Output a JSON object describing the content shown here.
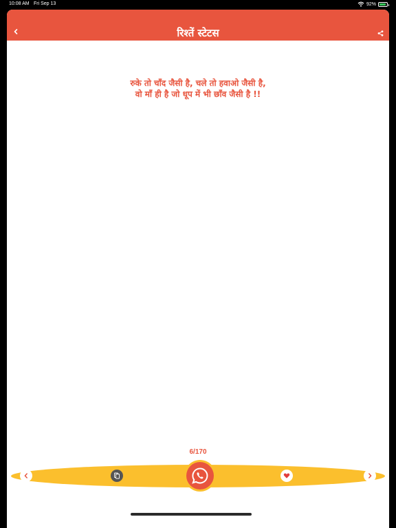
{
  "status_bar": {
    "time": "10:08 AM",
    "date": "Fri Sep 13",
    "battery": "92%"
  },
  "header": {
    "title": "रिश्तें स्टेटस"
  },
  "quote": {
    "line1": "रुके तो चाँद जैसी है, चले तो हवाओ जैसी है,",
    "line2": "वो माँ ही है जो धूप में भी छाँव जैसी है !!"
  },
  "counter": "6/170",
  "colors": {
    "accent": "#e8553e",
    "toolbar": "#fbbf2d"
  },
  "icons": {
    "back": "chevron-left-icon",
    "share": "share-icon",
    "prev": "chevron-left-icon",
    "copy": "copy-icon",
    "whatsapp": "whatsapp-icon",
    "favorite": "heart-icon",
    "next": "chevron-right-icon"
  }
}
